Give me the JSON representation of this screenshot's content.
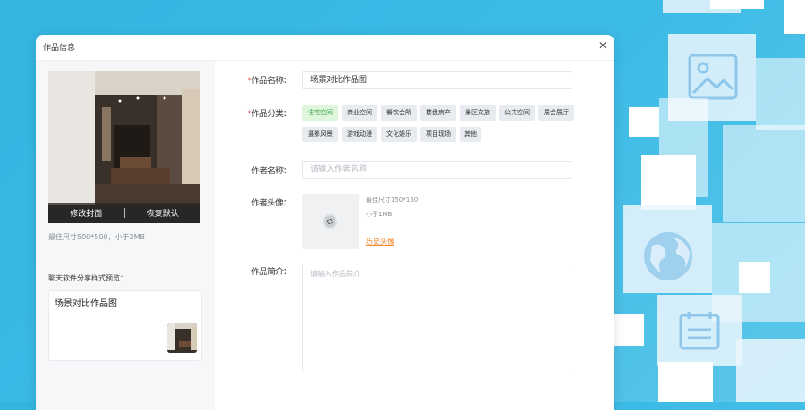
{
  "dialog": {
    "title": "作品信息",
    "close_icon": "close-icon"
  },
  "cover": {
    "edit_label": "修改封面",
    "reset_label": "恢复默认",
    "hint": "最佳尺寸500*500，小于2MB"
  },
  "preview": {
    "label": "聊天软件分享样式预览：",
    "title": "场景对比作品图"
  },
  "form": {
    "name_label": "作品名称：",
    "name_value": "场景对比作品图",
    "category_label": "作品分类：",
    "categories": [
      "住宅空间",
      "商业空间",
      "餐饮会所",
      "楼盘房产",
      "景区文旅",
      "公共空间",
      "展会展厅",
      "摄影风景",
      "游戏动漫",
      "文化娱乐",
      "项目现场",
      "其他"
    ],
    "selected_category": "住宅空间",
    "author_label": "作者名称：",
    "author_placeholder": "请输入作者名称",
    "avatar_label": "作者头像：",
    "avatar_size_hint": "最佳尺寸150*150",
    "avatar_file_hint": "小于1MB",
    "avatar_history_link": "历史头像",
    "intro_label": "作品简介：",
    "intro_placeholder": "请输入作品简介"
  },
  "colors": {
    "background": "#3cbbe6",
    "selected_tag_bg": "#dff5dc",
    "selected_tag_text": "#3aa24a",
    "link": "#f28b2e",
    "required": "#e0453a"
  },
  "decor_icons": [
    "image-icon",
    "globe-icon",
    "calendar-icon"
  ]
}
